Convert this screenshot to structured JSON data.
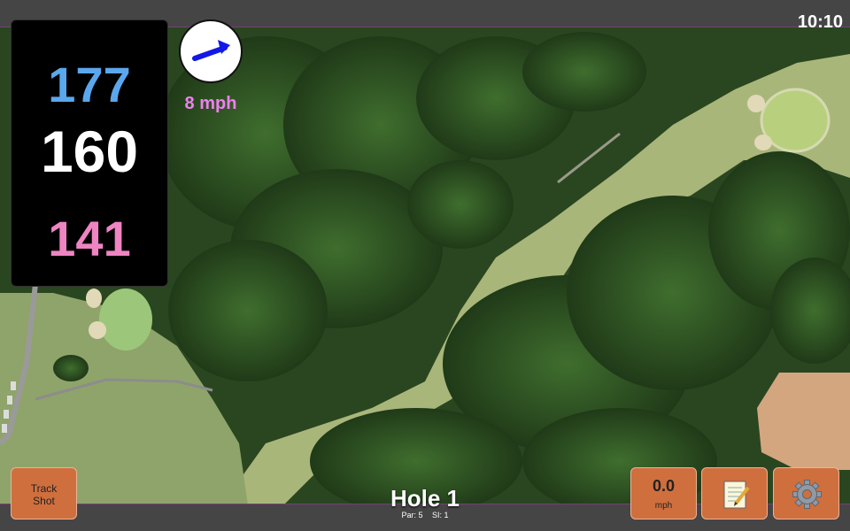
{
  "status": {
    "time": "10:10"
  },
  "distances": {
    "back": "177",
    "middle": "160",
    "front": "141"
  },
  "wind": {
    "speed": "8 mph",
    "direction": "east-northeast",
    "icon": "wind-arrow-icon"
  },
  "hole": {
    "title": "Hole 1",
    "par": "Par: 5",
    "si": "SI: 1"
  },
  "buttons": {
    "track_shot": {
      "line1": "Track",
      "line2": "Shot"
    },
    "speed": {
      "value": "0.0",
      "unit": "mph"
    },
    "notes_icon": "notepad-icon",
    "settings_icon": "gear-icon"
  },
  "colors": {
    "back_distance": "#5aa7ee",
    "middle_distance": "#ffffff",
    "front_distance": "#ef84c2",
    "wind_text": "#ee80f0",
    "button": "#cf6f3e"
  }
}
